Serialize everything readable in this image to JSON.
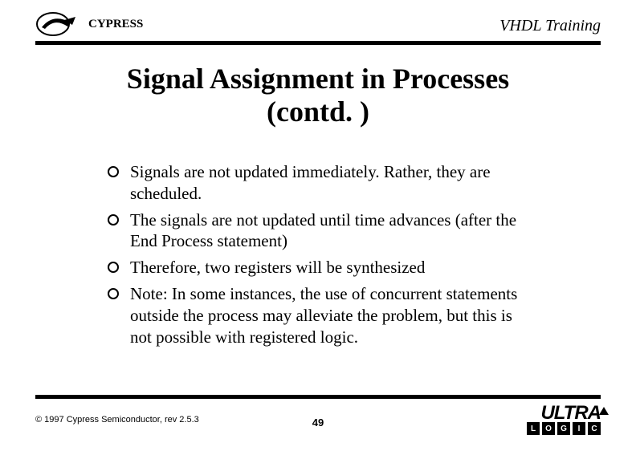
{
  "header": {
    "brand": "CYPRESS",
    "training": "VHDL Training"
  },
  "title_line1": "Signal Assignment in Processes",
  "title_line2": "(contd. )",
  "bullets": [
    "Signals are not updated immediately. Rather, they are scheduled.",
    "The signals are not updated until time advances (after the End Process statement)",
    "Therefore, two registers will be synthesized",
    "Note: In some instances, the use of concurrent statements outside the process may alleviate the problem, but this is not possible with registered logic."
  ],
  "footer": {
    "copyright": "© 1997 Cypress Semiconductor, rev 2.5.3",
    "page": "49",
    "ultra": "ULTRA",
    "logic": [
      "L",
      "O",
      "G",
      "I",
      "C"
    ]
  }
}
